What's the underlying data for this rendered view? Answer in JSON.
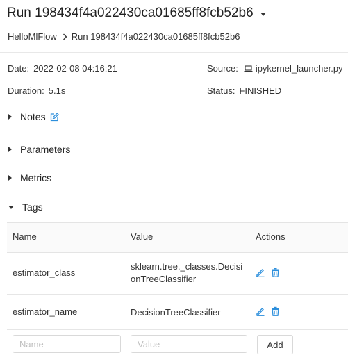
{
  "header": {
    "title": "Run 198434f4a022430ca01685ff8fcb52b6"
  },
  "breadcrumb": {
    "experiment": "HelloMlFlow",
    "current": "Run 198434f4a022430ca01685ff8fcb52b6"
  },
  "meta": {
    "date_label": "Date:",
    "date_value": "2022-02-08 04:16:21",
    "source_label": "Source:",
    "source_value": "ipykernel_launcher.py",
    "duration_label": "Duration:",
    "duration_value": "5.1s",
    "status_label": "Status:",
    "status_value": "FINISHED"
  },
  "sections": {
    "notes": "Notes",
    "parameters": "Parameters",
    "metrics": "Metrics",
    "tags": "Tags"
  },
  "tags_table": {
    "columns": [
      "Name",
      "Value",
      "Actions"
    ],
    "rows": [
      {
        "name": "estimator_class",
        "value": "sklearn.tree._classes.DecisionTreeClassifier"
      },
      {
        "name": "estimator_name",
        "value": "DecisionTreeClassifier"
      }
    ],
    "name_placeholder": "Name",
    "value_placeholder": "Value",
    "add_label": "Add"
  },
  "colors": {
    "accent": "#2d8fdc",
    "text": "#333333",
    "border": "#d9d9d9"
  },
  "icons": {
    "title_menu": "caret-down-icon",
    "breadcrumb_sep": "chevron-right-icon",
    "source": "laptop-icon",
    "notes_edit": "edit-icon",
    "row_edit": "pencil-icon",
    "row_delete": "trash-icon"
  }
}
